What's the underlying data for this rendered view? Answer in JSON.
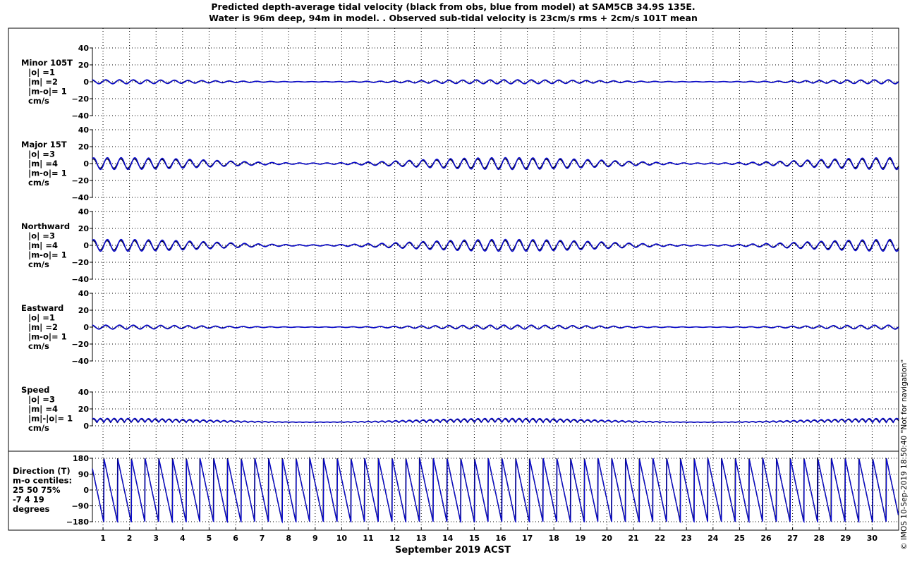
{
  "title_line1": "Predicted depth-average tidal velocity (black from obs, blue from model) at SAM5CB 34.9S 135E.",
  "title_line2": "Water is 96m deep, 94m in model. . Observed sub-tidal velocity is 23cm/s rms + 2cm/s 101T mean",
  "footer_note": "© IMOS 10-Sep-2019 18:50:40  \"Not for navigation\"",
  "colors": {
    "obs": "#000000",
    "model": "#0a0acc",
    "grid": "#000000"
  },
  "chart_data": {
    "type": "line",
    "xlabel": "September 2019 ACST",
    "x_tick_labels": [
      "1",
      "2",
      "3",
      "4",
      "5",
      "6",
      "7",
      "8",
      "9",
      "10",
      "11",
      "12",
      "13",
      "14",
      "15",
      "16",
      "17",
      "18",
      "19",
      "20",
      "21",
      "22",
      "23",
      "24",
      "25",
      "26",
      "27",
      "28",
      "29",
      "30"
    ],
    "xlim_days": [
      0.6,
      31.0
    ],
    "series_names": [
      "obs",
      "model"
    ],
    "panels": [
      {
        "id": "minor",
        "label_lines": [
          "Minor 105T",
          "|o| =1",
          "|m| =2",
          "|m-o|= 1",
          "cm/s"
        ],
        "ylim": [
          -40,
          40
        ],
        "yticks": [
          "40",
          "20",
          "0",
          "−20",
          "−40"
        ],
        "tidal_amplitude_obs": 2,
        "tidal_amplitude_model": 2.4,
        "mean": 0
      },
      {
        "id": "major",
        "label_lines": [
          "Major 15T",
          "|o| =3",
          "|m| =4",
          "|m-o|= 1",
          "cm/s"
        ],
        "ylim": [
          -40,
          40
        ],
        "yticks": [
          "40",
          "20",
          "0",
          "−20",
          "−40"
        ],
        "tidal_amplitude_obs": 5.5,
        "tidal_amplitude_model": 7,
        "mean": 0
      },
      {
        "id": "northward",
        "label_lines": [
          "Northward",
          "|o| =3",
          "|m| =4",
          "|m-o|= 1",
          "cm/s"
        ],
        "ylim": [
          -40,
          40
        ],
        "yticks": [
          "40",
          "20",
          "0",
          "−20",
          "−40"
        ],
        "tidal_amplitude_obs": 5.5,
        "tidal_amplitude_model": 7,
        "mean": 0
      },
      {
        "id": "eastward",
        "label_lines": [
          "Eastward",
          "|o| =1",
          "|m| =2",
          "|m-o|= 1",
          "cm/s"
        ],
        "ylim": [
          -40,
          40
        ],
        "yticks": [
          "40",
          "20",
          "0",
          "−20",
          "−40"
        ],
        "tidal_amplitude_obs": 2,
        "tidal_amplitude_model": 2.4,
        "mean": 0
      },
      {
        "id": "speed",
        "label_lines": [
          "Speed",
          "|o| =3",
          "|m| =4",
          "|m|-|o|= 1",
          "cm/s"
        ],
        "ylim": [
          0,
          40
        ],
        "yticks": [
          "40",
          "20",
          "0"
        ],
        "tidal_amplitude_obs": 5,
        "tidal_amplitude_model": 6,
        "mean": 4
      },
      {
        "id": "direction",
        "label_lines": [
          "Direction (T)",
          "m-o centiles:",
          "25  50  75%",
          "-7   4  19",
          "degrees"
        ],
        "ylim": [
          -180,
          180
        ],
        "yticks": [
          "180",
          "90",
          "0",
          "−90",
          "−180"
        ]
      }
    ]
  }
}
